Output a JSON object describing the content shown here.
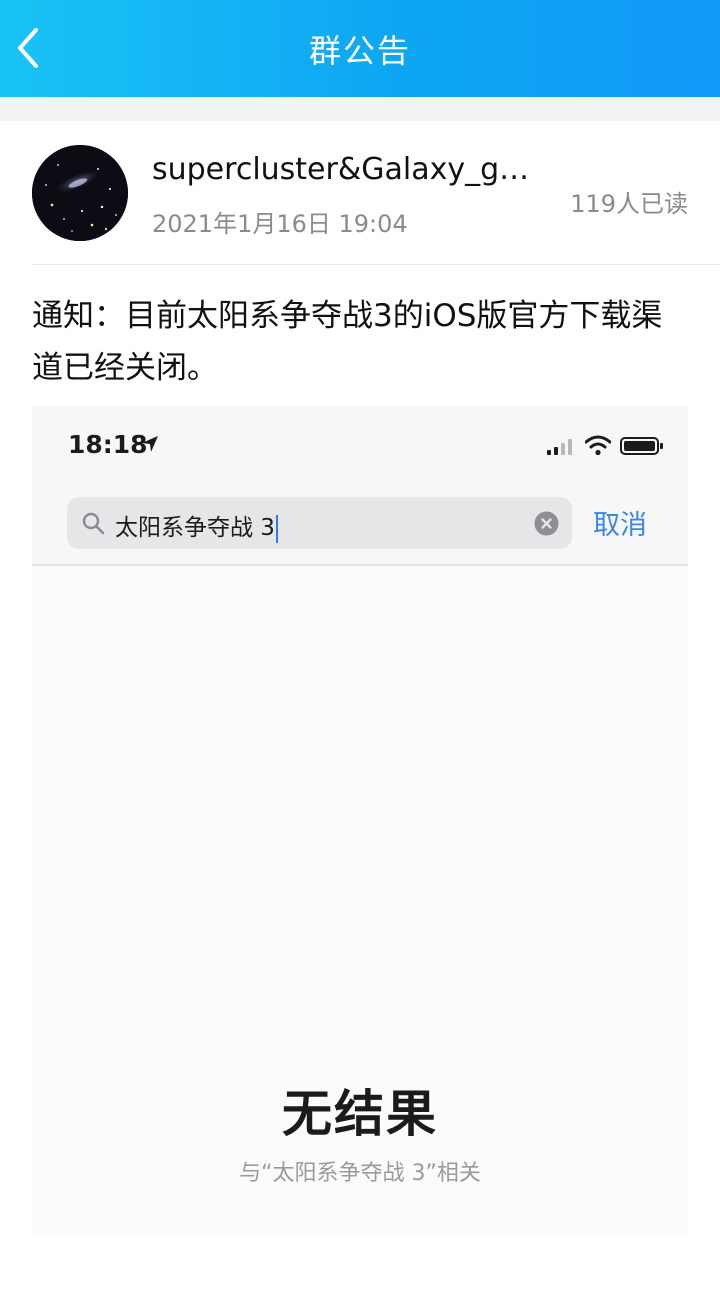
{
  "header": {
    "title": "群公告",
    "back_icon": "chevron-left-icon",
    "gradient_colors": [
      "#19c3f6",
      "#1099f7"
    ]
  },
  "post": {
    "author_name": "supercluster&Galaxy_gr...",
    "timestamp": "2021年1月16日 19:04",
    "read_count": "119人已读",
    "content": "通知：目前太阳系争夺战3的iOS版官方下载渠道已经关闭。"
  },
  "embedded_screenshot": {
    "status_bar": {
      "time": "18:18",
      "icons": [
        "location-arrow-icon",
        "cellular-signal-icon",
        "wifi-icon",
        "battery-icon"
      ]
    },
    "search": {
      "icon": "search-icon",
      "query": "太阳系争夺战 3",
      "clear_icon": "clear-circle-icon",
      "cancel_label": "取消"
    },
    "no_results_title": "无结果",
    "no_results_subtitle": "与“太阳系争夺战 3”相关",
    "accent_color": "#3a86ea"
  }
}
